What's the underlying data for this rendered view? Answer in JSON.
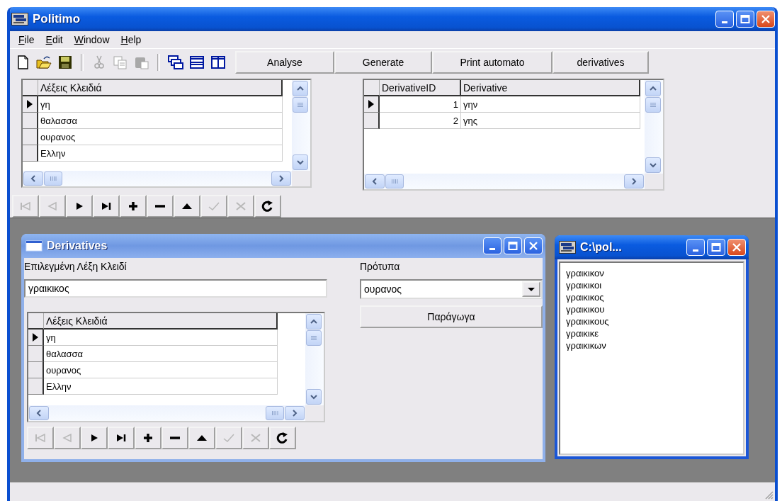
{
  "window": {
    "title": "Politimo"
  },
  "menu": [
    {
      "label": "File"
    },
    {
      "label": "Edit"
    },
    {
      "label": "Window"
    },
    {
      "label": "Help"
    }
  ],
  "toolbar": {
    "groups": [
      [
        {
          "kind": "new",
          "disabled": false
        },
        {
          "kind": "open",
          "disabled": false
        },
        {
          "kind": "save",
          "disabled": false
        }
      ],
      [
        {
          "kind": "cut",
          "disabled": true
        },
        {
          "kind": "copy",
          "disabled": true
        },
        {
          "kind": "paste",
          "disabled": true
        }
      ],
      [
        {
          "kind": "cascade",
          "disabled": false
        },
        {
          "kind": "tile_horizontal",
          "disabled": false
        },
        {
          "kind": "tile_vertical",
          "disabled": false
        }
      ]
    ],
    "buttons": [
      "Analyse",
      "Generate",
      "Print automato",
      "derivatives"
    ]
  },
  "keywords_grid": {
    "columns": [
      "Λέξεις Κλειδιά"
    ],
    "rows": [
      {
        "cells": [
          "γη"
        ],
        "selected": true
      },
      {
        "cells": [
          "θαλασσα"
        ],
        "selected": false
      },
      {
        "cells": [
          "ουρανος"
        ],
        "selected": false
      },
      {
        "cells": [
          "Ελλην"
        ],
        "selected": false
      }
    ]
  },
  "navigator": [
    {
      "kind": "first",
      "disabled": true
    },
    {
      "kind": "prior",
      "disabled": true
    },
    {
      "kind": "next",
      "disabled": false
    },
    {
      "kind": "last",
      "disabled": false
    },
    {
      "kind": "insert",
      "disabled": false
    },
    {
      "kind": "delete",
      "disabled": false
    },
    {
      "kind": "edit",
      "disabled": false
    },
    {
      "kind": "post",
      "disabled": true
    },
    {
      "kind": "cancel",
      "disabled": true
    },
    {
      "kind": "refresh",
      "disabled": false
    }
  ],
  "derivatives_grid": {
    "columns": [
      "DerivativeID",
      "Derivative"
    ],
    "rows": [
      {
        "cells": [
          "1",
          "γην"
        ],
        "selected": true
      },
      {
        "cells": [
          "2",
          "γης"
        ],
        "selected": false
      }
    ]
  },
  "derivatives_window": {
    "title": "Derivatives",
    "active": false,
    "keyword_label": "Επιλεγμένη Λέξη Κλειδί",
    "keyword_value": "γραικικος",
    "template_label": "Πρότυπα",
    "template_value": "ουρανος",
    "generate_button": "Παράγωγα",
    "grid": {
      "columns": [
        "Λέξεις Κλειδιά"
      ],
      "rows": [
        {
          "cells": [
            "γη"
          ],
          "selected": true
        },
        {
          "cells": [
            "θαλασσα"
          ],
          "selected": false
        },
        {
          "cells": [
            "ουρανος"
          ],
          "selected": false
        },
        {
          "cells": [
            "Ελλην"
          ],
          "selected": false
        }
      ]
    },
    "navigator": [
      {
        "kind": "first",
        "disabled": true
      },
      {
        "kind": "prior",
        "disabled": true
      },
      {
        "kind": "next",
        "disabled": false
      },
      {
        "kind": "last",
        "disabled": false
      },
      {
        "kind": "insert",
        "disabled": false
      },
      {
        "kind": "delete",
        "disabled": false
      },
      {
        "kind": "edit",
        "disabled": false
      },
      {
        "kind": "post",
        "disabled": true
      },
      {
        "kind": "cancel",
        "disabled": true
      },
      {
        "kind": "refresh",
        "disabled": false
      }
    ]
  },
  "console_window": {
    "title": "C:\\pol...",
    "active": true,
    "lines": [
      "γραικικον",
      "γραικικοι",
      "γραικικος",
      "γραικικου",
      "γραικικους",
      "γραικικε",
      "γραικικων"
    ]
  }
}
